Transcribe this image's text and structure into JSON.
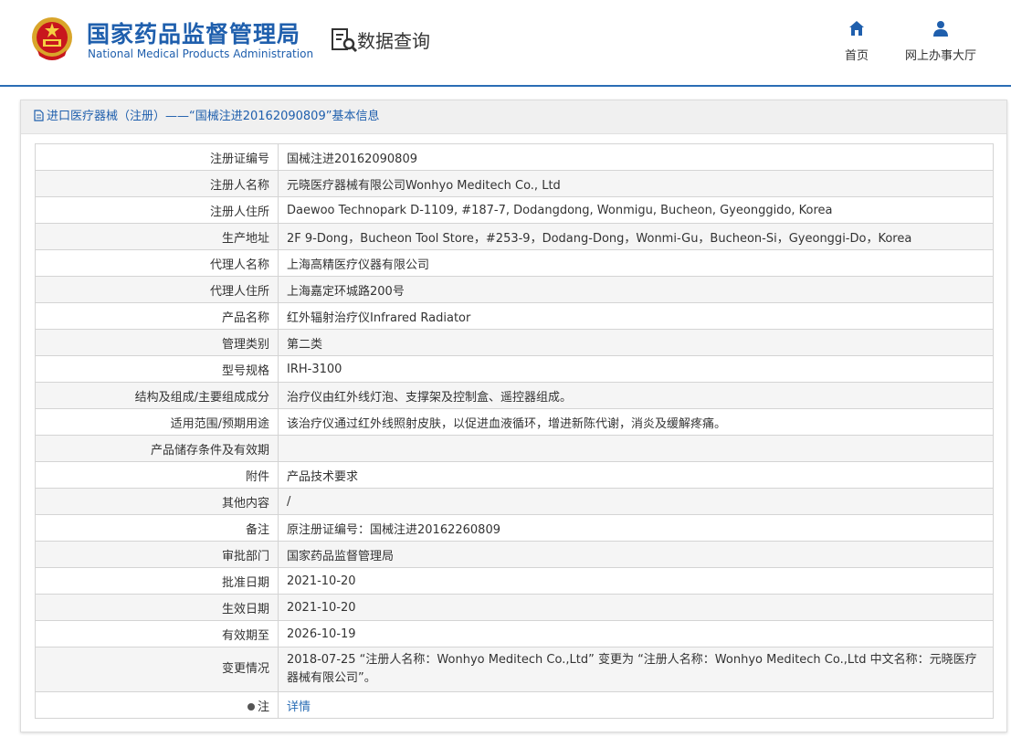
{
  "header": {
    "brand_cn": "国家药品监督管理局",
    "brand_en": "National Medical Products Administration",
    "query_title": "数据查询",
    "nav": [
      {
        "label": "首页",
        "icon": "home-icon"
      },
      {
        "label": "网上办事大厅",
        "icon": "user-icon"
      }
    ]
  },
  "panel": {
    "title": "进口医疗器械（注册）——“国械注进20162090809”基本信息"
  },
  "rows": [
    {
      "label": "注册证编号",
      "value": "国械注进20162090809"
    },
    {
      "label": "注册人名称",
      "value": "元晓医疗器械有限公司Wonhyo Meditech Co., Ltd"
    },
    {
      "label": "注册人住所",
      "value": "Daewoo Technopark D-1109, #187-7, Dodangdong, Wonmigu, Bucheon, Gyeonggido, Korea"
    },
    {
      "label": "生产地址",
      "value": "2F 9-Dong，Bucheon Tool Store，#253-9，Dodang-Dong，Wonmi-Gu，Bucheon-Si，Gyeonggi-Do，Korea"
    },
    {
      "label": "代理人名称",
      "value": "上海高精医疗仪器有限公司"
    },
    {
      "label": "代理人住所",
      "value": "上海嘉定环城路200号"
    },
    {
      "label": "产品名称",
      "value": "红外辐射治疗仪Infrared Radiator"
    },
    {
      "label": "管理类别",
      "value": "第二类"
    },
    {
      "label": "型号规格",
      "value": "IRH-3100"
    },
    {
      "label": "结构及组成/主要组成成分",
      "value": "治疗仪由红外线灯泡、支撑架及控制盒、遥控器组成。"
    },
    {
      "label": "适用范围/预期用途",
      "value": "该治疗仪通过红外线照射皮肤，以促进血液循环，增进新陈代谢，消炎及缓解疼痛。"
    },
    {
      "label": "产品储存条件及有效期",
      "value": ""
    },
    {
      "label": "附件",
      "value": "产品技术要求"
    },
    {
      "label": "其他内容",
      "value": "/"
    },
    {
      "label": "备注",
      "value": "原注册证编号：国械注进20162260809"
    },
    {
      "label": "审批部门",
      "value": "国家药品监督管理局"
    },
    {
      "label": "批准日期",
      "value": "2021-10-20"
    },
    {
      "label": "生效日期",
      "value": "2021-10-20"
    },
    {
      "label": "有效期至",
      "value": "2026-10-19"
    },
    {
      "label": "变更情况",
      "value": "2018-07-25 “注册人名称：Wonhyo Meditech Co.,Ltd” 变更为 “注册人名称：Wonhyo Meditech Co.,Ltd 中文名称：元晓医疗器械有限公司”。"
    },
    {
      "label": "注",
      "value": "详情"
    }
  ]
}
